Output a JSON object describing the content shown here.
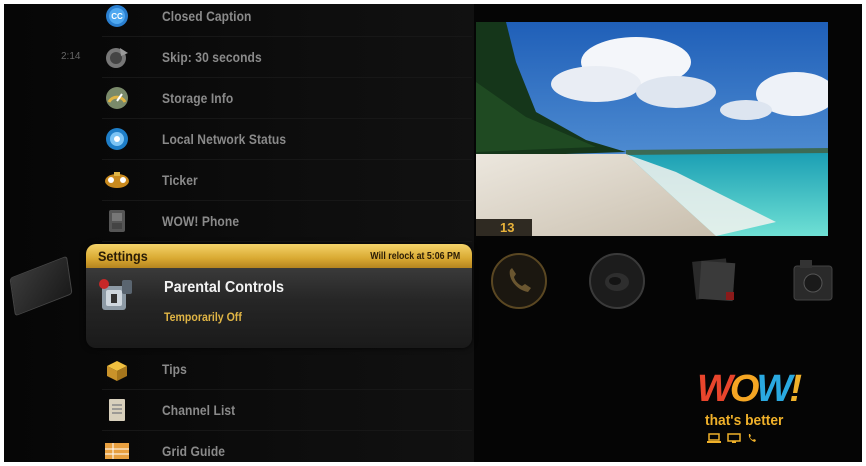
{
  "status": {
    "time": "2:14"
  },
  "menu": {
    "items": [
      {
        "label": "Closed Caption",
        "icon": "closed-caption-icon"
      },
      {
        "label": "Skip: 30 seconds",
        "icon": "skip-icon"
      },
      {
        "label": "Storage Info",
        "icon": "storage-gauge-icon"
      },
      {
        "label": "Local Network Status",
        "icon": "network-globe-icon"
      },
      {
        "label": "Ticker",
        "icon": "ticker-icon"
      },
      {
        "label": "WOW! Phone",
        "icon": "phone-icon"
      }
    ],
    "items_after": [
      {
        "label": "Tips",
        "icon": "tips-box-icon"
      },
      {
        "label": "Channel List",
        "icon": "channel-list-icon"
      },
      {
        "label": "Grid Guide",
        "icon": "grid-guide-icon"
      }
    ]
  },
  "settings_card": {
    "title": "Settings",
    "relock": "Will relock at 5:06 PM",
    "item_label": "Parental Controls",
    "item_status": "Temporarily Off"
  },
  "preview": {
    "channel": "13"
  },
  "apps": [
    "phone-app-icon",
    "music-app-icon",
    "photos-app-icon",
    "media-app-icon"
  ],
  "brand": {
    "logo": "WOW!",
    "tagline": "that's better",
    "colors": {
      "w1": "#e8452c",
      "o": "#f5a623",
      "w2": "#2aa9e0",
      "bang": "#f0b12a"
    }
  },
  "theme": {
    "accent": "#e0b545",
    "header_gold": "#d9a932"
  }
}
